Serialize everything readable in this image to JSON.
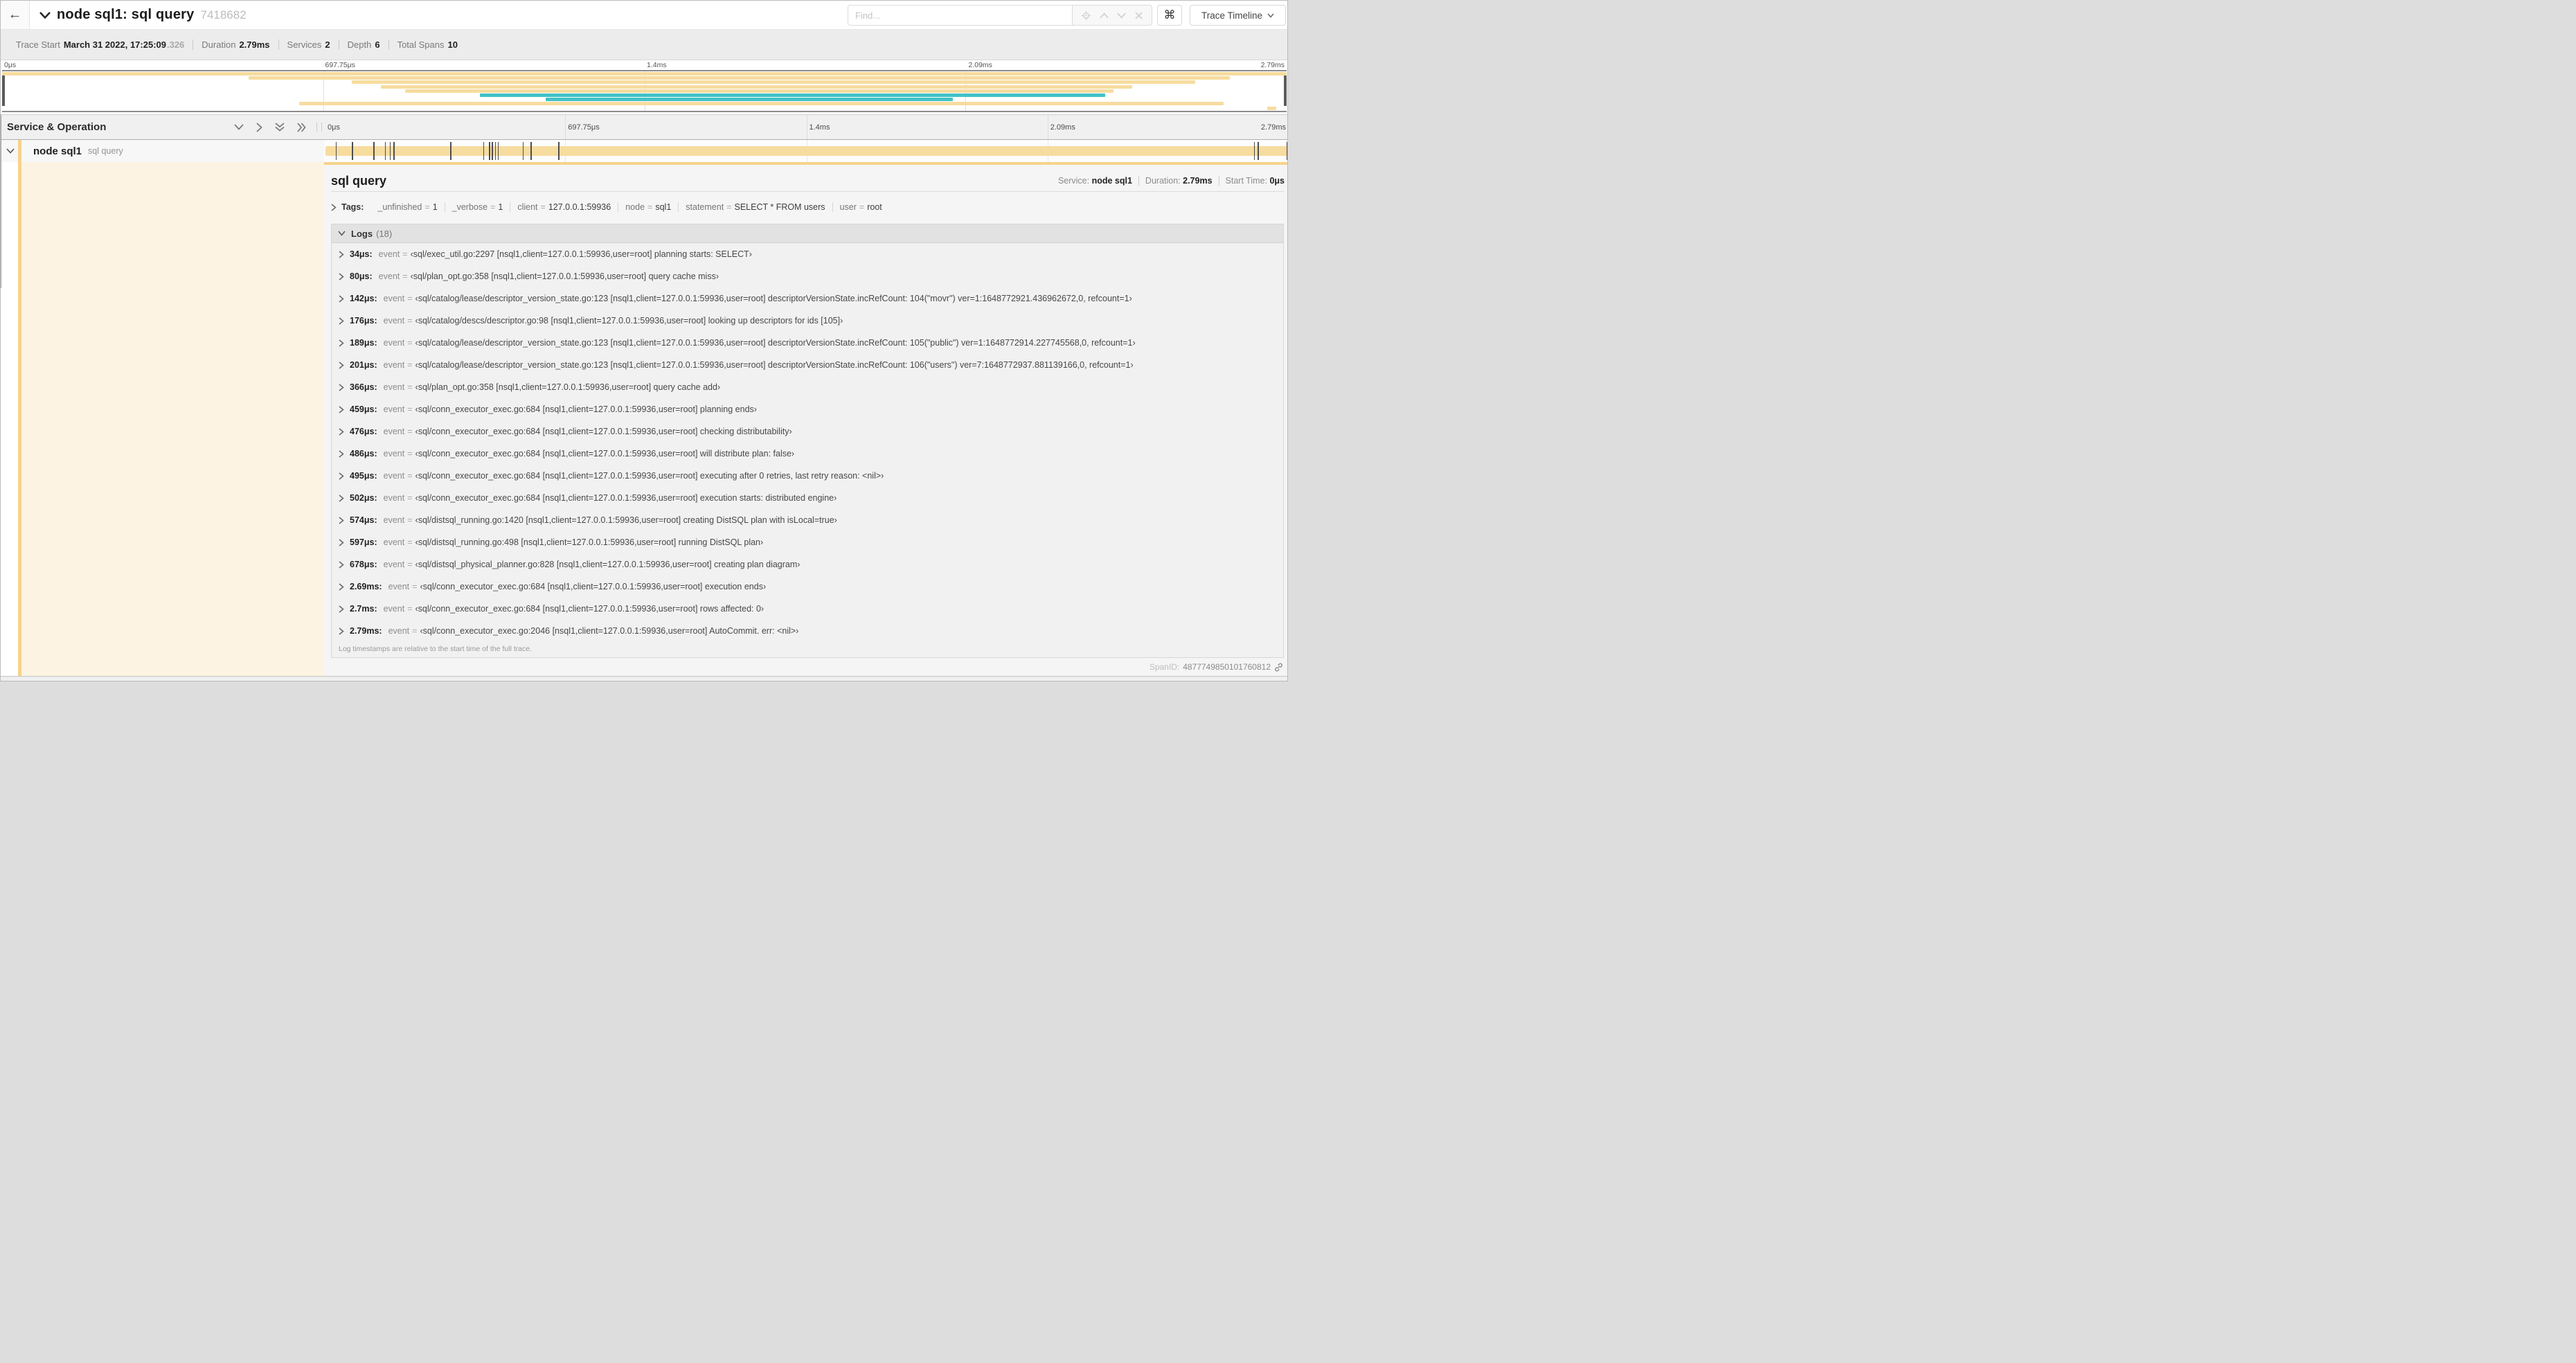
{
  "colors": {
    "tan": "#F5D38B",
    "tan_light": "#F7DC9F",
    "teal": "#41C2C6",
    "cream": "#FCF3E2"
  },
  "header": {
    "title": "node sql1: sql query",
    "trace_id_short": "7418682",
    "find_placeholder": "Find...",
    "cmd_button": "⌘",
    "view_button": "Trace Timeline"
  },
  "summary": {
    "items": [
      {
        "label": "Trace Start",
        "value": "March 31 2022, 17:25:09",
        "suffix": ".326"
      },
      {
        "label": "Duration",
        "value": "2.79ms"
      },
      {
        "label": "Services",
        "value": "2"
      },
      {
        "label": "Depth",
        "value": "6"
      },
      {
        "label": "Total Spans",
        "value": "10"
      }
    ]
  },
  "timeline": {
    "ticks": [
      "0μs",
      "697.75μs",
      "1.4ms",
      "2.09ms",
      "2.79ms"
    ],
    "minimap_rows": [
      {
        "color": "tan",
        "left": 0,
        "width": 100
      },
      {
        "color": "tan",
        "left": 19.2,
        "width": 76.4
      },
      {
        "color": "tan",
        "left": 27.2,
        "width": 65.7
      },
      {
        "color": "tan",
        "left": 29.5,
        "width": 58.5
      },
      {
        "color": "tan",
        "left": 31.4,
        "width": 55.1
      },
      {
        "color": "teal",
        "left": 37.2,
        "width": 48.7
      },
      {
        "color": "teal",
        "left": 42.3,
        "width": 31.7
      },
      {
        "color": "tan",
        "left": 23.1,
        "width": 72.0
      },
      {
        "color": "tan",
        "left": 98.5,
        "width": 0.7
      }
    ],
    "markers_pct": [
      1.2,
      2.9,
      5.1,
      6.3,
      6.8,
      7.2,
      13.1,
      16.5,
      17.1,
      17.4,
      17.7,
      18.0,
      20.6,
      21.4,
      24.3,
      96.4,
      96.8,
      99.8
    ]
  },
  "tree": {
    "header": "Service & Operation",
    "row": {
      "service": "node sql1",
      "operation": "sql query"
    }
  },
  "detail": {
    "title": "sql query",
    "meta": [
      {
        "label": "Service:",
        "value": "node sql1"
      },
      {
        "label": "Duration:",
        "value": "2.79ms"
      },
      {
        "label": "Start Time:",
        "value": "0μs"
      }
    ],
    "tags_label": "Tags:",
    "tags_eq": "=",
    "tags": [
      {
        "key": "_unfinished",
        "value": "1"
      },
      {
        "key": "_verbose",
        "value": "1"
      },
      {
        "key": "client",
        "value": "127.0.0.1:59936"
      },
      {
        "key": "node",
        "value": "sql1"
      },
      {
        "key": "statement",
        "value": "SELECT * FROM users"
      },
      {
        "key": "user",
        "value": "root"
      }
    ],
    "logs_title": "Logs",
    "logs_count": "(18)",
    "log_field": "event",
    "log_eq": "=",
    "logs": [
      {
        "time": "34μs:",
        "value": "‹sql/exec_util.go:2297 [nsql1,client=127.0.0.1:59936,user=root] planning starts: SELECT›"
      },
      {
        "time": "80μs:",
        "value": "‹sql/plan_opt.go:358 [nsql1,client=127.0.0.1:59936,user=root] query cache miss›"
      },
      {
        "time": "142μs:",
        "value": "‹sql/catalog/lease/descriptor_version_state.go:123 [nsql1,client=127.0.0.1:59936,user=root] descriptorVersionState.incRefCount: 104(\"movr\") ver=1:1648772921.436962672,0, refcount=1›"
      },
      {
        "time": "176μs:",
        "value": "‹sql/catalog/descs/descriptor.go:98 [nsql1,client=127.0.0.1:59936,user=root] looking up descriptors for ids [105]›"
      },
      {
        "time": "189μs:",
        "value": "‹sql/catalog/lease/descriptor_version_state.go:123 [nsql1,client=127.0.0.1:59936,user=root] descriptorVersionState.incRefCount: 105(\"public\") ver=1:1648772914.227745568,0, refcount=1›"
      },
      {
        "time": "201μs:",
        "value": "‹sql/catalog/lease/descriptor_version_state.go:123 [nsql1,client=127.0.0.1:59936,user=root] descriptorVersionState.incRefCount: 106(\"users\") ver=7:1648772937.881139166,0, refcount=1›"
      },
      {
        "time": "366μs:",
        "value": "‹sql/plan_opt.go:358 [nsql1,client=127.0.0.1:59936,user=root] query cache add›"
      },
      {
        "time": "459μs:",
        "value": "‹sql/conn_executor_exec.go:684 [nsql1,client=127.0.0.1:59936,user=root] planning ends›"
      },
      {
        "time": "476μs:",
        "value": "‹sql/conn_executor_exec.go:684 [nsql1,client=127.0.0.1:59936,user=root] checking distributability›"
      },
      {
        "time": "486μs:",
        "value": "‹sql/conn_executor_exec.go:684 [nsql1,client=127.0.0.1:59936,user=root] will distribute plan: false›"
      },
      {
        "time": "495μs:",
        "value": "‹sql/conn_executor_exec.go:684 [nsql1,client=127.0.0.1:59936,user=root] executing after 0 retries, last retry reason: <nil>›"
      },
      {
        "time": "502μs:",
        "value": "‹sql/conn_executor_exec.go:684 [nsql1,client=127.0.0.1:59936,user=root] execution starts: distributed engine›"
      },
      {
        "time": "574μs:",
        "value": "‹sql/distsql_running.go:1420 [nsql1,client=127.0.0.1:59936,user=root] creating DistSQL plan with isLocal=true›"
      },
      {
        "time": "597μs:",
        "value": "‹sql/distsql_running.go:498 [nsql1,client=127.0.0.1:59936,user=root] running DistSQL plan›"
      },
      {
        "time": "678μs:",
        "value": "‹sql/distsql_physical_planner.go:828 [nsql1,client=127.0.0.1:59936,user=root] creating plan diagram›"
      },
      {
        "time": "2.69ms:",
        "value": "‹sql/conn_executor_exec.go:684 [nsql1,client=127.0.0.1:59936,user=root] execution ends›"
      },
      {
        "time": "2.7ms:",
        "value": "‹sql/conn_executor_exec.go:684 [nsql1,client=127.0.0.1:59936,user=root] rows affected: 0›"
      },
      {
        "time": "2.79ms:",
        "value": "‹sql/conn_executor_exec.go:2046 [nsql1,client=127.0.0.1:59936,user=root] AutoCommit. err: <nil>›"
      }
    ],
    "logs_note": "Log timestamps are relative to the start time of the full trace.",
    "spanid_label": "SpanID:",
    "spanid_value": "4877749850101760812"
  }
}
